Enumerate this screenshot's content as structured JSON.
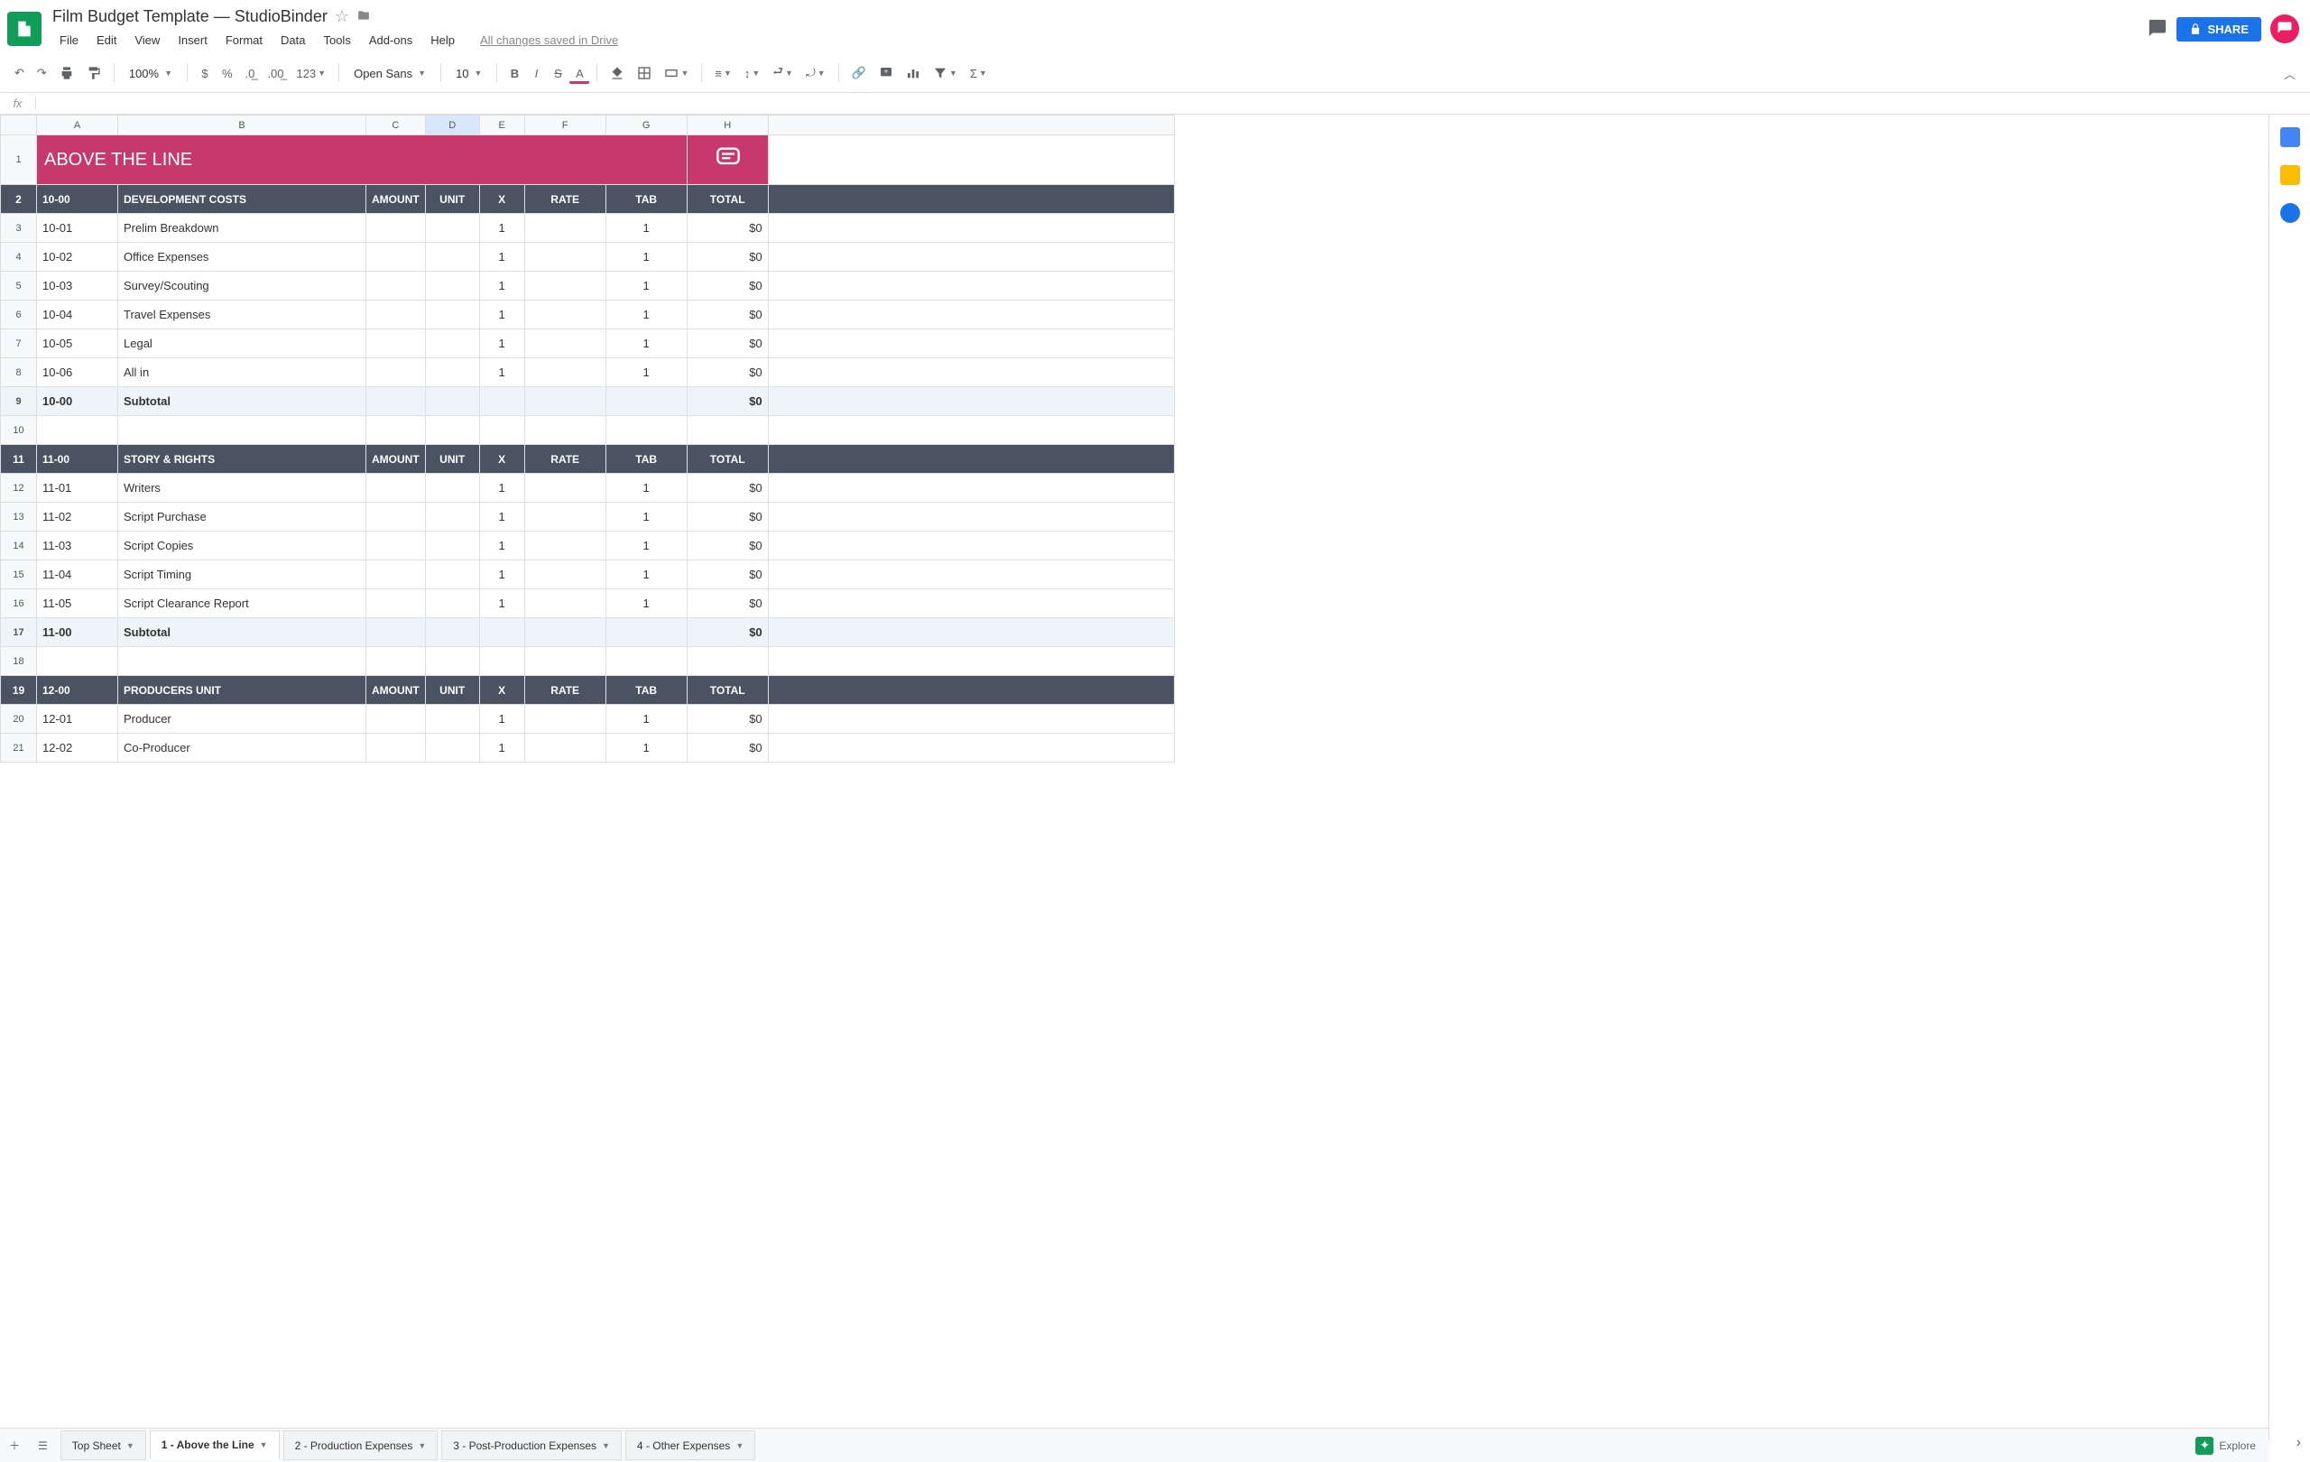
{
  "doc_title": "Film Budget Template — StudioBinder",
  "menu": [
    "File",
    "Edit",
    "View",
    "Insert",
    "Format",
    "Data",
    "Tools",
    "Add-ons",
    "Help"
  ],
  "saved_msg": "All changes saved in Drive",
  "share_label": "SHARE",
  "toolbar": {
    "zoom": "100%",
    "font": "Open Sans",
    "font_size": "10"
  },
  "columns": [
    "A",
    "B",
    "C",
    "D",
    "E",
    "F",
    "G",
    "H"
  ],
  "selected_col": "D",
  "banner_title": "ABOVE THE LINE",
  "section_headers": [
    "AMOUNT",
    "UNIT",
    "X",
    "RATE",
    "TAB",
    "TOTAL"
  ],
  "sections": [
    {
      "code": "10-00",
      "title": "DEVELOPMENT COSTS",
      "rows": [
        {
          "n": 3,
          "code": "10-01",
          "desc": "Prelim Breakdown",
          "x": "1",
          "tab": "1",
          "total": "$0"
        },
        {
          "n": 4,
          "code": "10-02",
          "desc": "Office Expenses",
          "x": "1",
          "tab": "1",
          "total": "$0"
        },
        {
          "n": 5,
          "code": "10-03",
          "desc": "Survey/Scouting",
          "x": "1",
          "tab": "1",
          "total": "$0"
        },
        {
          "n": 6,
          "code": "10-04",
          "desc": "Travel Expenses",
          "x": "1",
          "tab": "1",
          "total": "$0"
        },
        {
          "n": 7,
          "code": "10-05",
          "desc": "Legal",
          "x": "1",
          "tab": "1",
          "total": "$0"
        },
        {
          "n": 8,
          "code": "10-06",
          "desc": "All in",
          "x": "1",
          "tab": "1",
          "total": "$0"
        }
      ],
      "sub_row": 9,
      "sub_code": "10-00",
      "sub_label": "Subtotal",
      "sub_total": "$0",
      "blank_row": 10,
      "header_row": 2
    },
    {
      "code": "11-00",
      "title": "STORY & RIGHTS",
      "rows": [
        {
          "n": 12,
          "code": "11-01",
          "desc": "Writers",
          "x": "1",
          "tab": "1",
          "total": "$0"
        },
        {
          "n": 13,
          "code": "11-02",
          "desc": "Script Purchase",
          "x": "1",
          "tab": "1",
          "total": "$0"
        },
        {
          "n": 14,
          "code": "11-03",
          "desc": "Script Copies",
          "x": "1",
          "tab": "1",
          "total": "$0"
        },
        {
          "n": 15,
          "code": "11-04",
          "desc": "Script Timing",
          "x": "1",
          "tab": "1",
          "total": "$0"
        },
        {
          "n": 16,
          "code": "11-05",
          "desc": "Script Clearance Report",
          "x": "1",
          "tab": "1",
          "total": "$0"
        }
      ],
      "sub_row": 17,
      "sub_code": "11-00",
      "sub_label": "Subtotal",
      "sub_total": "$0",
      "blank_row": 18,
      "header_row": 11
    },
    {
      "code": "12-00",
      "title": "PRODUCERS UNIT",
      "rows": [
        {
          "n": 20,
          "code": "12-01",
          "desc": "Producer",
          "x": "1",
          "tab": "1",
          "total": "$0"
        },
        {
          "n": 21,
          "code": "12-02",
          "desc": "Co-Producer",
          "x": "1",
          "tab": "1",
          "total": "$0"
        }
      ],
      "sub_row": null,
      "header_row": 19
    }
  ],
  "tabs": [
    {
      "label": "Top Sheet",
      "active": false
    },
    {
      "label": "1 - Above the Line",
      "active": true
    },
    {
      "label": "2 - Production Expenses",
      "active": false
    },
    {
      "label": "3 - Post-Production Expenses",
      "active": false
    },
    {
      "label": "4 - Other Expenses",
      "active": false
    }
  ],
  "explore_label": "Explore"
}
